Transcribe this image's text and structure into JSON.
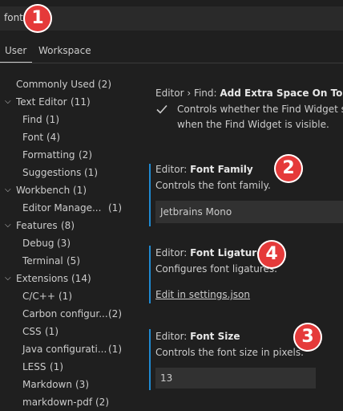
{
  "search": {
    "value": "font"
  },
  "tabs": [
    {
      "label": "User",
      "active": true
    },
    {
      "label": "Workspace",
      "active": false
    }
  ],
  "tree": [
    {
      "label": "Commonly Used",
      "count": "(2)",
      "level": 0,
      "expandable": false
    },
    {
      "label": "Text Editor",
      "count": "(11)",
      "level": 0,
      "expandable": true
    },
    {
      "label": "Find",
      "count": "(1)",
      "level": 1
    },
    {
      "label": "Font",
      "count": "(4)",
      "level": 1
    },
    {
      "label": "Formatting",
      "count": "(2)",
      "level": 1
    },
    {
      "label": "Suggestions",
      "count": "(1)",
      "level": 1
    },
    {
      "label": "Workbench",
      "count": "(1)",
      "level": 0,
      "expandable": true
    },
    {
      "label": "Editor Manage...",
      "count": "(1)",
      "level": 1
    },
    {
      "label": "Features",
      "count": "(8)",
      "level": 0,
      "expandable": true
    },
    {
      "label": "Debug",
      "count": "(3)",
      "level": 1
    },
    {
      "label": "Terminal",
      "count": "(5)",
      "level": 1
    },
    {
      "label": "Extensions",
      "count": "(14)",
      "level": 0,
      "expandable": true
    },
    {
      "label": "C/C++",
      "count": "(1)",
      "level": 1
    },
    {
      "label": "Carbon configur...",
      "count": "(2)",
      "level": 1
    },
    {
      "label": "CSS",
      "count": "(1)",
      "level": 1
    },
    {
      "label": "Java configurati...",
      "count": "(1)",
      "level": 1
    },
    {
      "label": "LESS",
      "count": "(1)",
      "level": 1
    },
    {
      "label": "Markdown",
      "count": "(3)",
      "level": 1
    },
    {
      "label": "markdown-pdf",
      "count": "(2)",
      "level": 1
    }
  ],
  "settings": {
    "find": {
      "prefix": "Editor › Find: ",
      "name": "Add Extra Space On Top",
      "desc_line1": "Controls whether the Find Widget sh",
      "desc_line2": "when the Find Widget is visible.",
      "checked": true
    },
    "font_family": {
      "prefix": "Editor: ",
      "name": "Font Family",
      "desc": "Controls the font family.",
      "value": "Jetbrains Mono"
    },
    "font_ligatures": {
      "prefix": "Editor: ",
      "name": "Font Ligatures",
      "desc": "Configures font ligatures.",
      "link": "Edit in settings.json"
    },
    "font_size": {
      "prefix": "Editor: ",
      "name": "Font Size",
      "desc": "Controls the font size in pixels.",
      "value": "13"
    }
  },
  "badges": [
    "1",
    "2",
    "3",
    "4"
  ],
  "colors": {
    "accent_bar": "#1f8ad2",
    "badge": "#e53a3a",
    "background": "#1f1f1f",
    "input": "#313131"
  }
}
